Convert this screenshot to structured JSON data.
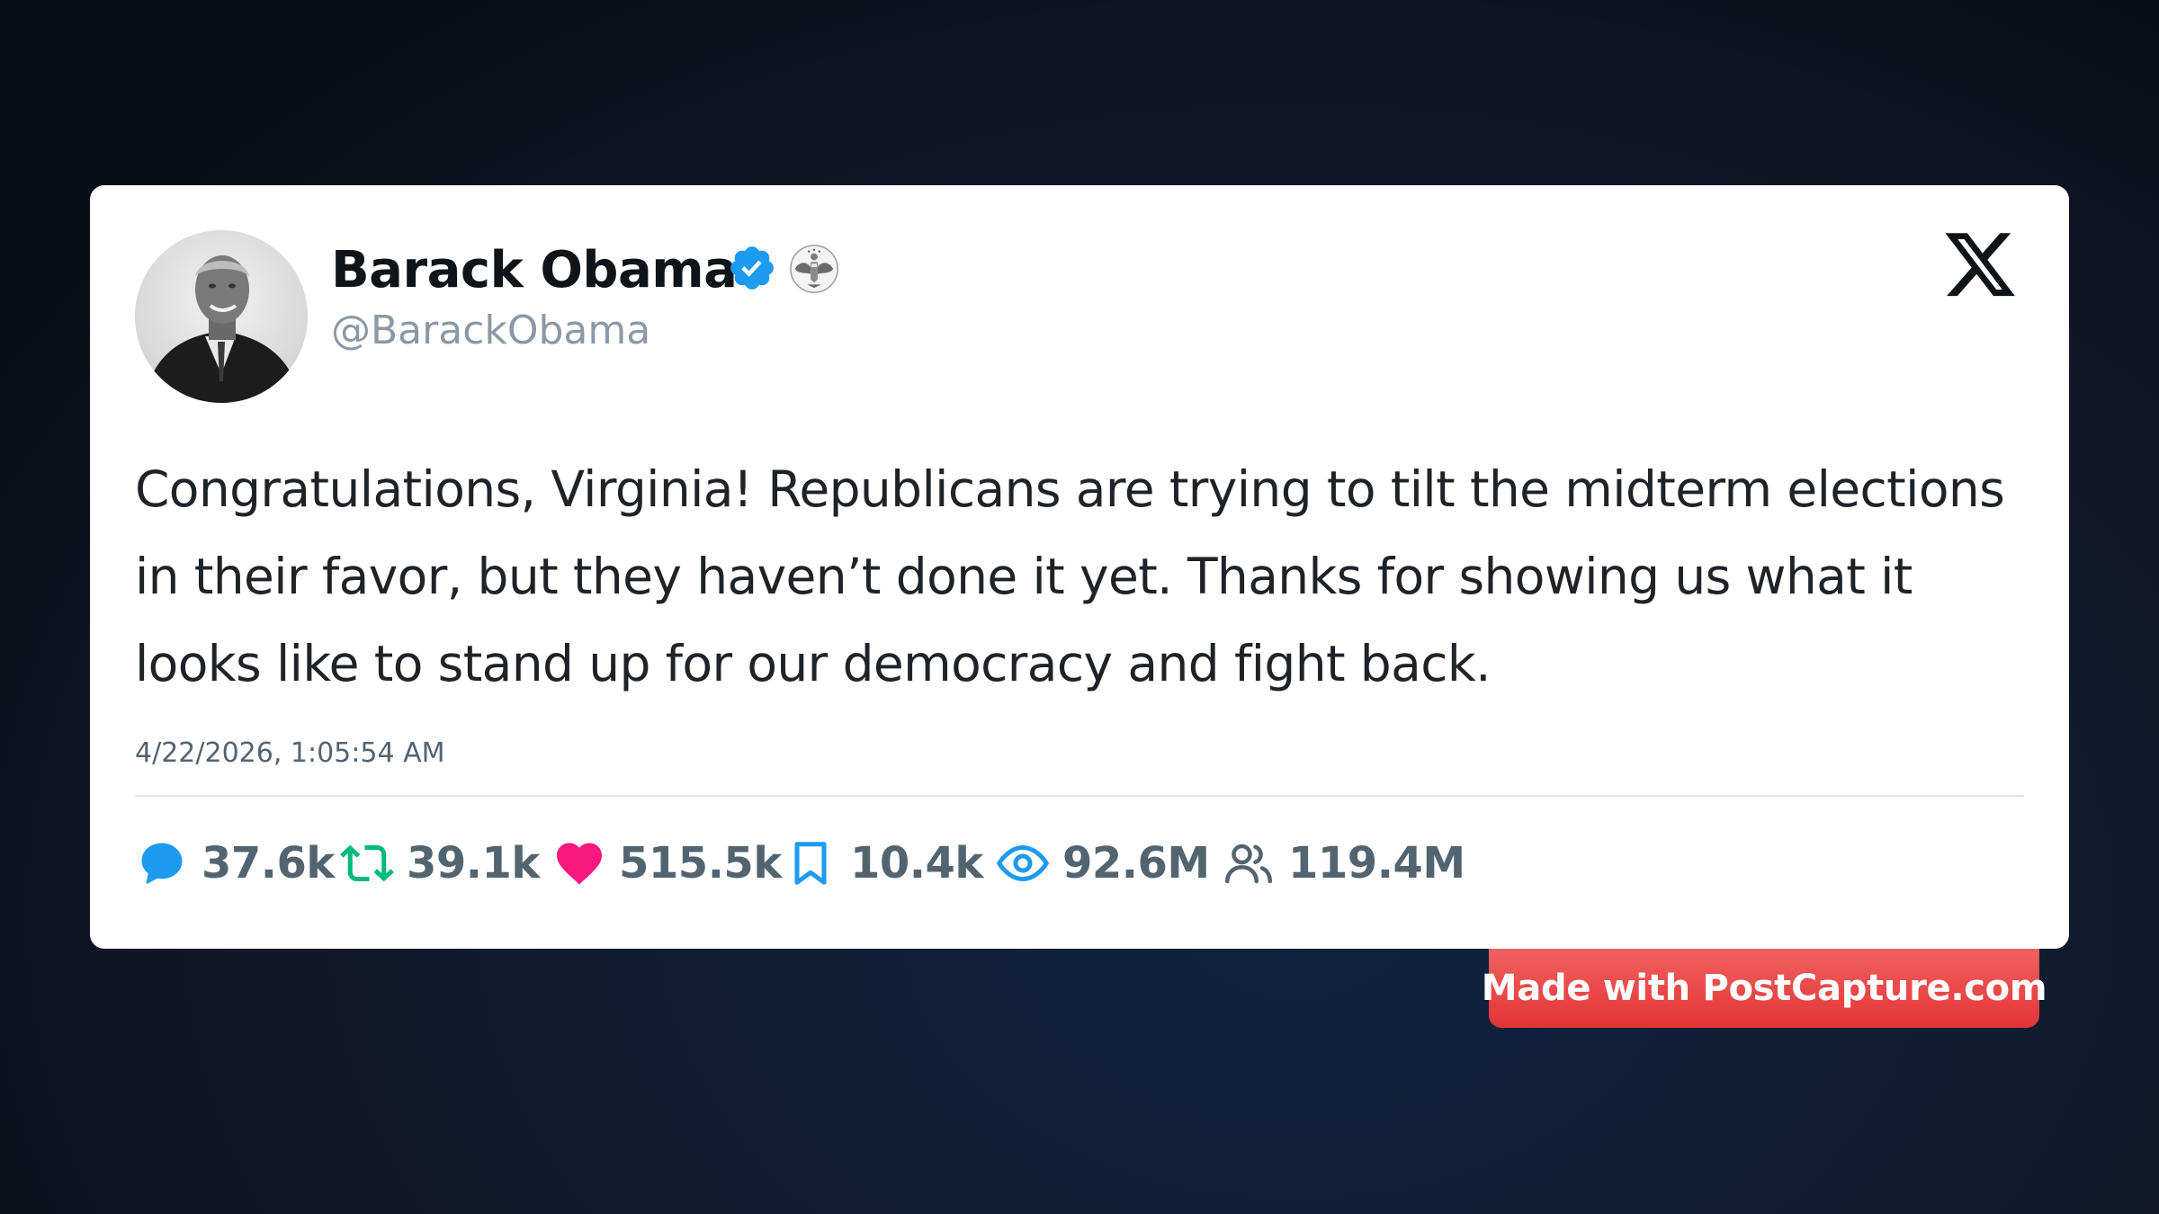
{
  "author": {
    "name": "Barack Obama",
    "handle": "@BarackObama",
    "verified_icon": "verified-badge-icon",
    "affiliation_icon": "presidential-seal-icon"
  },
  "platform_logo": "x-logo-icon",
  "tweet": {
    "text": "Congratulations, Virginia! Republicans are trying to tilt the midterm elections in their favor, but they haven’t done it yet. Thanks for showing us what it looks like to stand up for our democracy and fight back.",
    "timestamp": "4/22/2026, 1:05:54 AM"
  },
  "stats": {
    "replies": "37.6k",
    "retweets": "39.1k",
    "likes": "515.5k",
    "bookmarks": "10.4k",
    "views": "92.6M",
    "followers": "119.4M"
  },
  "watermark": {
    "text": "Made with PostCapture.com"
  },
  "colors": {
    "verified": "#1d9bf0",
    "reply": "#1d9bf0",
    "retweet": "#00ba7c",
    "like": "#f91880",
    "bookmark": "#1d9bf0",
    "views": "#1d9bf0",
    "followers": "#536471",
    "badge": "#e23535"
  }
}
